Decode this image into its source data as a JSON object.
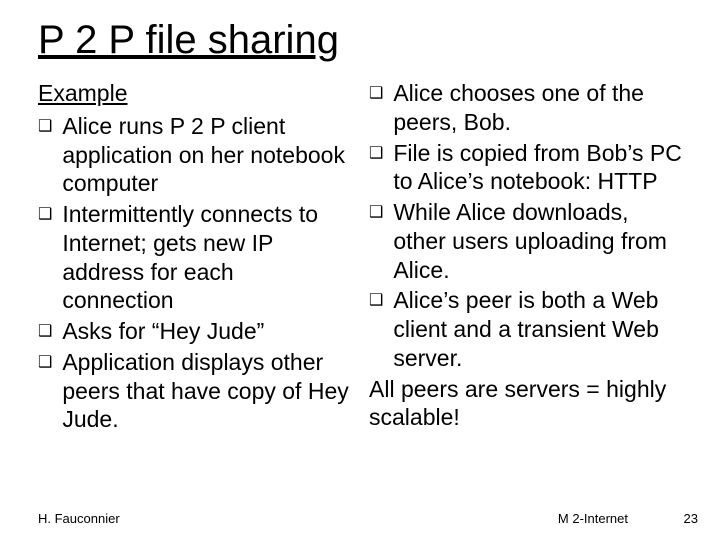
{
  "title": "P 2 P file sharing",
  "left": {
    "subhead": "Example",
    "bullets": [
      "Alice runs P 2 P client application on her notebook computer",
      "Intermittently connects to Internet; gets new IP address for each connection",
      "Asks for “Hey Jude”",
      "Application displays other peers that have copy of Hey Jude."
    ]
  },
  "right": {
    "bullets": [
      "Alice chooses one of the peers, Bob.",
      "File is copied from Bob’s PC to Alice’s notebook: HTTP",
      "While Alice downloads, other users uploading from Alice.",
      "Alice’s peer is both a Web client and a transient Web server."
    ],
    "closing": "All peers are servers = highly scalable!"
  },
  "footer": {
    "author": "H. Fauconnier",
    "course": "M 2-Internet",
    "page": "23"
  },
  "bullet_glyph": "❑"
}
